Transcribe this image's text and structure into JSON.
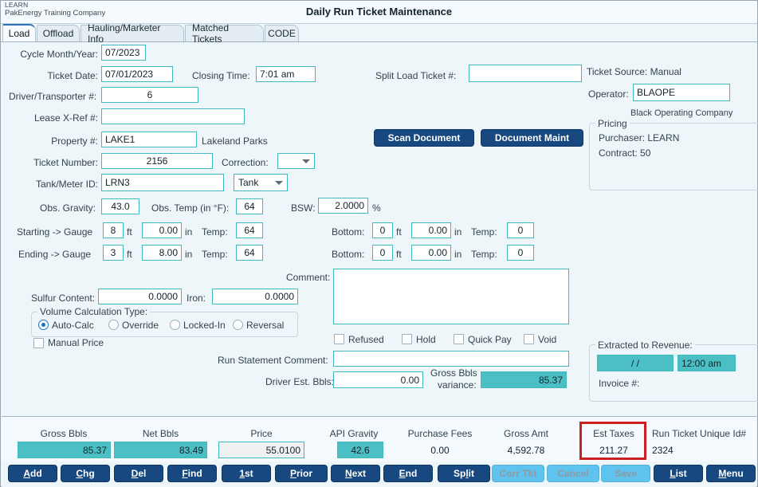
{
  "window": {
    "brand_code": "LEARN",
    "brand_company": "PakEnergy Training Company",
    "title": "Daily Run Ticket Maintenance"
  },
  "tabs": [
    {
      "label": "Load",
      "active": true
    },
    {
      "label": "Offload",
      "active": false
    },
    {
      "label": "Hauling/Marketer Info",
      "active": false
    },
    {
      "label": "Matched Tickets",
      "active": false
    },
    {
      "label": "CODE",
      "active": false
    }
  ],
  "form": {
    "cycle_month_year_label": "Cycle Month/Year:",
    "cycle_month_year": "07/2023",
    "ticket_date_label": "Ticket Date:",
    "ticket_date": "07/01/2023",
    "closing_time_label": "Closing Time:",
    "closing_time": "7:01 am",
    "split_load_ticket_label": "Split Load Ticket #:",
    "split_load_ticket": "",
    "driver_transporter_label": "Driver/Transporter #:",
    "driver_transporter": "6",
    "lease_xref_label": "Lease X-Ref #:",
    "lease_xref": "",
    "property_label": "Property #:",
    "property": "LAKE1",
    "property_name": "Lakeland Parks",
    "ticket_number_label": "Ticket Number:",
    "ticket_number": "2156",
    "correction_label": "Correction:",
    "correction": "",
    "tank_meter_label": "Tank/Meter ID:",
    "tank_meter": "LRN3",
    "tank_type": "Tank",
    "obs_gravity_label": "Obs. Gravity:",
    "obs_gravity": "43.0",
    "obs_temp_label": "Obs. Temp (in °F):",
    "obs_temp": "64",
    "bsw_label": "BSW:",
    "bsw": "2.0000",
    "bsw_unit": "%",
    "starting_gauge_label": "Starting -> Gauge",
    "starting_ft": "8",
    "starting_in": "0.00",
    "starting_temp": "64",
    "ending_gauge_label": "Ending -> Gauge",
    "ending_ft": "3",
    "ending_in": "8.00",
    "ending_temp": "64",
    "bottom_label": "Bottom:",
    "bottom1_ft": "0",
    "bottom1_in": "0.00",
    "bottom1_temp": "0",
    "bottom2_ft": "0",
    "bottom2_in": "0.00",
    "bottom2_temp": "0",
    "unit_ft": "ft",
    "unit_in": "in",
    "temp_label": "Temp:",
    "comment_label": "Comment:",
    "comment": "",
    "sulfur_label": "Sulfur Content:",
    "sulfur": "0.0000",
    "iron_label": "Iron:",
    "iron": "0.0000",
    "run_stmt_comment_label": "Run Statement Comment:",
    "run_stmt_comment": "",
    "driver_est_bbls_label": "Driver Est. Bbls:",
    "driver_est_bbls": "0.00",
    "gross_bbls_variance_label_l1": "Gross Bbls",
    "gross_bbls_variance_label_l2": "variance:",
    "gross_bbls_variance": "85.37"
  },
  "volume_calc": {
    "title": "Volume Calculation Type:",
    "options": [
      {
        "label": "Auto-Calc",
        "selected": true
      },
      {
        "label": "Override",
        "selected": false
      },
      {
        "label": "Locked-In",
        "selected": false
      },
      {
        "label": "Reversal",
        "selected": false
      }
    ],
    "manual_price_label": "Manual Price",
    "manual_price_checked": false
  },
  "status_checks": [
    {
      "label": "Refused",
      "checked": false
    },
    {
      "label": "Hold",
      "checked": false
    },
    {
      "label": "Quick Pay",
      "checked": false
    },
    {
      "label": "Void",
      "checked": false
    }
  ],
  "doc_buttons": {
    "scan": "Scan Document",
    "maint": "Document Maint"
  },
  "right_panel": {
    "ticket_source": "Ticket Source: Manual",
    "operator_label": "Operator:",
    "operator": "BLAOPE",
    "operator_name": "Black Operating Company",
    "pricing_title": "Pricing",
    "purchaser": "Purchaser: LEARN",
    "contract": "Contract: 50"
  },
  "extracted": {
    "title": "Extracted to Revenue:",
    "date": "/  /",
    "time": "12:00 am",
    "invoice_label": "Invoice #:"
  },
  "summary": [
    {
      "label": "Gross Bbls",
      "value": "85.37",
      "style": "teal"
    },
    {
      "label": "Net Bbls",
      "value": "83.49",
      "style": "teal"
    },
    {
      "label": "Price",
      "value": "55.0100",
      "style": "grey"
    },
    {
      "label": "API Gravity",
      "value": "42.6",
      "style": "teal"
    },
    {
      "label": "Purchase Fees",
      "value": "0.00",
      "style": "plain"
    },
    {
      "label": "Gross Amt",
      "value": "4,592.78",
      "style": "plain"
    },
    {
      "label": "Est Taxes",
      "value": "211.27",
      "style": "plain"
    },
    {
      "label": "Run Ticket Unique Id#",
      "value": "2324",
      "style": "plain"
    }
  ],
  "action_buttons": [
    {
      "label": "Add",
      "accel": "A",
      "disabled": false
    },
    {
      "label": "Chg",
      "accel": "C",
      "disabled": false
    },
    {
      "label": "Del",
      "accel": "D",
      "disabled": false
    },
    {
      "label": "Find",
      "accel": "F",
      "disabled": false
    },
    {
      "label": "1st",
      "accel": "1",
      "disabled": false
    },
    {
      "label": "Prior",
      "accel": "P",
      "disabled": false
    },
    {
      "label": "Next",
      "accel": "N",
      "disabled": false
    },
    {
      "label": "End",
      "accel": "E",
      "disabled": false
    },
    {
      "label": "Split",
      "accel": "l",
      "disabled": false
    },
    {
      "label": "Corr Tkt",
      "accel": "",
      "disabled": true
    },
    {
      "label": "Cancel",
      "accel": "",
      "disabled": true
    },
    {
      "label": "Save",
      "accel": "",
      "disabled": true
    },
    {
      "label": "List",
      "accel": "L",
      "disabled": false
    },
    {
      "label": "Menu",
      "accel": "M",
      "disabled": false
    }
  ],
  "colors": {
    "teal_fill": "#4cbfc4",
    "teal_border": "#3fb8bf",
    "btn_navy": "#17487f",
    "annotation_red": "#cc1f1f"
  }
}
